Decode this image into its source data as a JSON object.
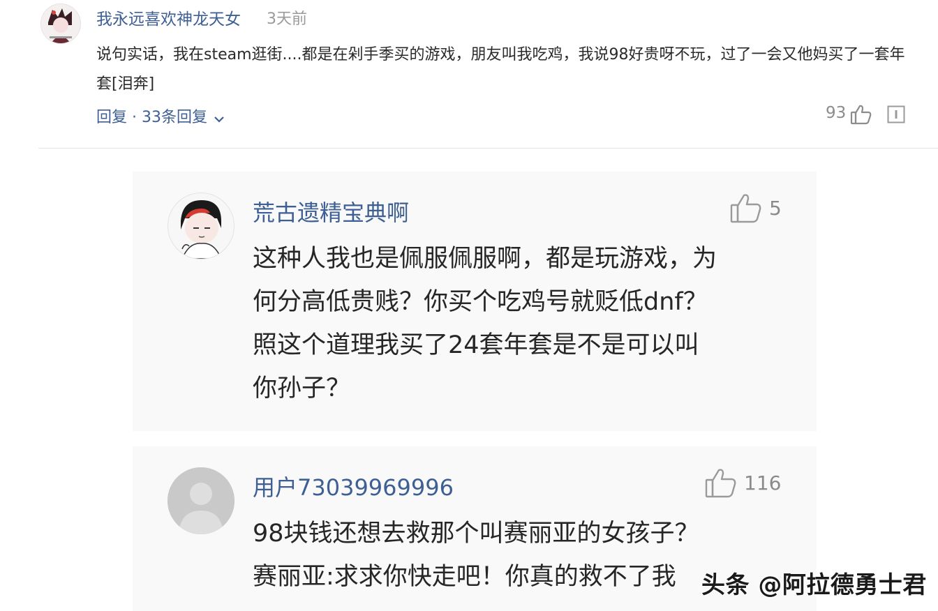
{
  "main_comment": {
    "username": "我永远喜欢神龙天女",
    "time": "3天前",
    "text": "说句实话，我在steam逛街....都是在剁手季买的游戏，朋友叫我吃鸡，我说98好贵呀不玩，过了一会又他妈买了一套年套[泪奔]",
    "reply_label": "回复 · 33条回复",
    "likes": "93"
  },
  "replies": [
    {
      "username": "荒古遗精宝典啊",
      "likes": "5",
      "lines": [
        "这种人我也是佩服佩服啊，都是玩游戏，为",
        "何分高低贵贱？你买个吃鸡号就贬低dnf？",
        "照这个道理我买了24套年套是不是可以叫",
        "你孙子？"
      ]
    },
    {
      "username": "用户73039969996",
      "likes": "116",
      "lines": [
        "98块钱还想去救那个叫赛丽亚的女孩子？",
        "赛丽亚:求求你快走吧！你真的救不了我"
      ]
    }
  ],
  "watermark": "头条 @阿拉德勇士君",
  "colors": {
    "username": "#3e5f94",
    "muted": "#9a9a9a",
    "reply_bg": "#f9f9f9"
  },
  "icons": [
    "thumbs-up-icon",
    "more-icon",
    "chevron-down-icon"
  ]
}
